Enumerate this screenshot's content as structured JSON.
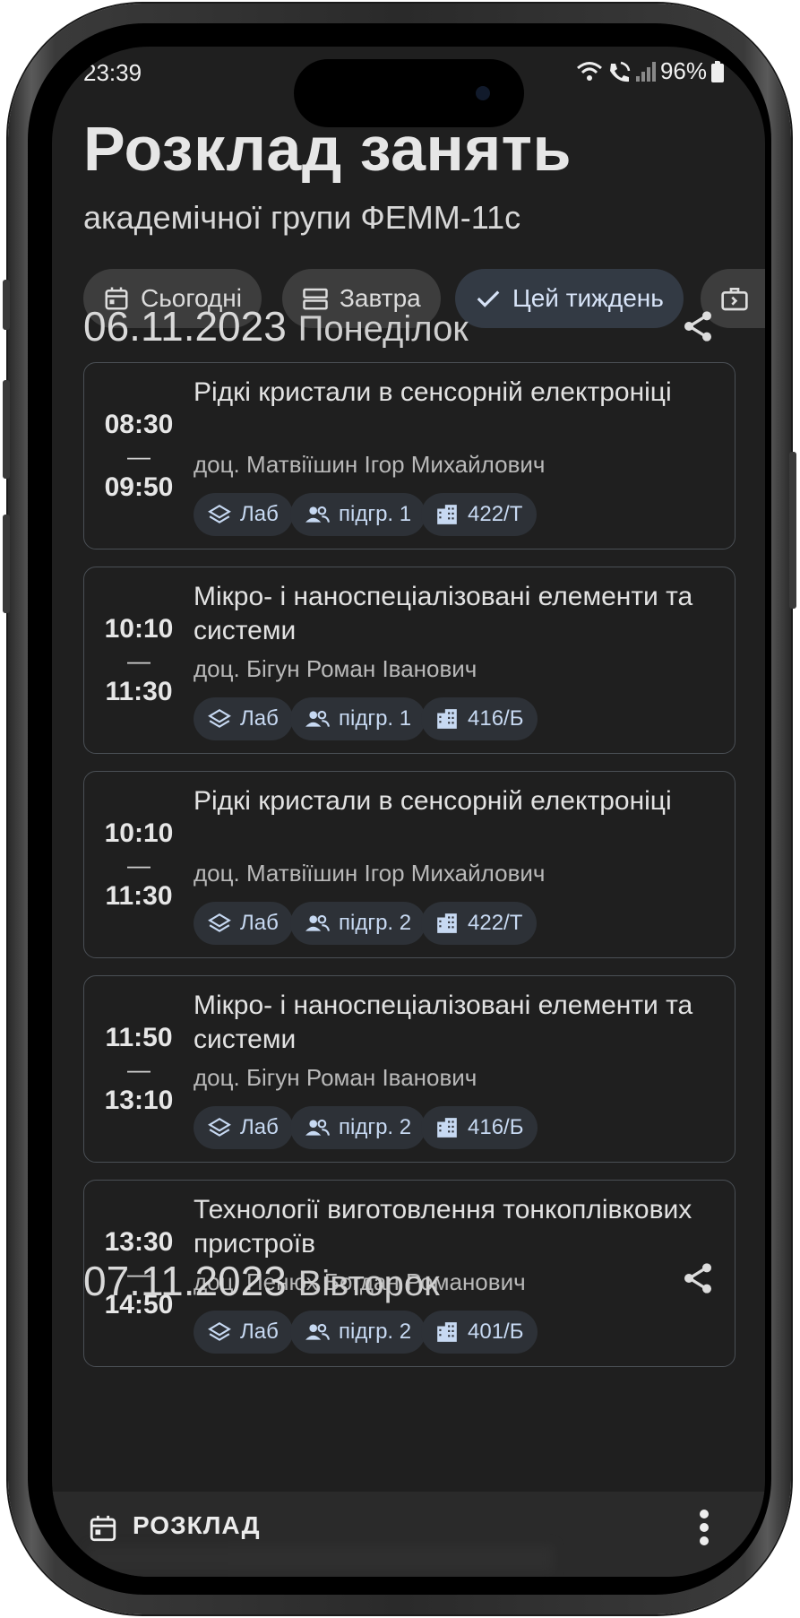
{
  "status_bar": {
    "time": "23:39",
    "battery": "96%"
  },
  "header": {
    "title": "Розклад занять",
    "subtitle": "академічної групи ФЕММ-11с"
  },
  "filters": [
    {
      "label": "Сьогодні",
      "icon": "calendar-today-icon",
      "selected": false
    },
    {
      "label": "Завтра",
      "icon": "view-agenda-icon",
      "selected": false
    },
    {
      "label": "Цей тиждень",
      "icon": "check-icon",
      "selected": true
    },
    {
      "label": "",
      "icon": "briefcase-arrow-icon",
      "selected": false
    }
  ],
  "days": [
    {
      "date": "06.11.2023",
      "weekday": "Понеділок",
      "lessons": [
        {
          "start": "08:30",
          "end": "09:50",
          "subject": "Рідкі кристали в сенсорній електроніці",
          "teacher": "доц. Матвіїшин Ігор Михайлович",
          "type": "Лаб",
          "subgroup": "підгр. 1",
          "room": "422/Т"
        },
        {
          "start": "10:10",
          "end": "11:30",
          "subject": "Мікро- і наноспеціалізовані елементи та системи",
          "teacher": "доц. Бігун Роман Іванович",
          "type": "Лаб",
          "subgroup": "підгр. 1",
          "room": "416/Б"
        },
        {
          "start": "10:10",
          "end": "11:30",
          "subject": "Рідкі кристали в сенсорній електроніці",
          "teacher": "доц. Матвіїшин Ігор Михайлович",
          "type": "Лаб",
          "subgroup": "підгр. 2",
          "room": "422/Т"
        },
        {
          "start": "11:50",
          "end": "13:10",
          "subject": "Мікро- і наноспеціалізовані елементи та системи",
          "teacher": "доц. Бігун Роман Іванович",
          "type": "Лаб",
          "subgroup": "підгр. 2",
          "room": "416/Б"
        },
        {
          "start": "13:30",
          "end": "14:50",
          "subject": "Технології виготовлення тонкоплівкових пристроїв",
          "teacher": "доц. Пенюх Богдан Романович",
          "type": "Лаб",
          "subgroup": "підгр. 2",
          "room": "401/Б"
        }
      ]
    },
    {
      "date": "07.11.2023",
      "weekday": "Вівторок",
      "lessons": []
    }
  ],
  "bottom_bar": {
    "label": "РОЗКЛАД"
  },
  "colors": {
    "background": "#1f1f1f",
    "chip_selected": "#333a44",
    "accent": "#c7d9f2",
    "card_border": "#4a4f55"
  }
}
